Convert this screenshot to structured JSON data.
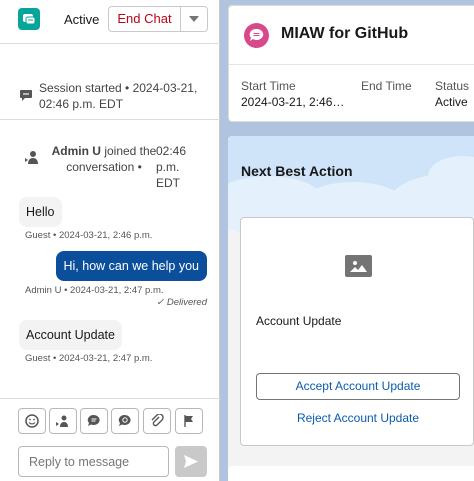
{
  "chat": {
    "status": "Active",
    "end_chat_label": "End Chat",
    "session_started": "Session started • 2024-03-21, 02:46 p.m. EDT",
    "joined": {
      "name": "Admin U",
      "text": "joined the conversation •",
      "time": "02:46 p.m. EDT"
    },
    "messages": [
      {
        "text": "Hello",
        "meta": "Guest • 2024-03-21, 2:46 p.m."
      },
      {
        "text": "Hi, how can we help you",
        "meta": "Admin U • 2024-03-21, 2:47 p.m.",
        "status": "Delivered"
      },
      {
        "text": "Account Update",
        "meta": "Guest • 2024-03-21, 2:47 p.m."
      }
    ],
    "reply_placeholder": "Reply to message",
    "toolbar_icons": [
      "emoji-icon",
      "transfer-icon",
      "quick-text-icon",
      "knowledge-icon",
      "attach-icon",
      "flag-icon"
    ]
  },
  "miaw": {
    "title": "MIAW for GitHub",
    "columns": [
      {
        "header": "Start Time",
        "value": "2024-03-21, 2:46…"
      },
      {
        "header": "End Time",
        "value": ""
      },
      {
        "header": "Status",
        "value": "Active"
      }
    ]
  },
  "nba": {
    "title": "Next Best Action",
    "recommendation": "Account Update",
    "accept_label": "Accept Account Update",
    "reject_label": "Reject Account Update"
  },
  "colors": {
    "app_icon": "#06a59a",
    "end_chat_text": "#ba0517",
    "outgoing_bubble": "#0b4f9c",
    "miaw_icon": "#d8498b",
    "link": "#0b5cab",
    "page_bg": "#b0c4df"
  }
}
